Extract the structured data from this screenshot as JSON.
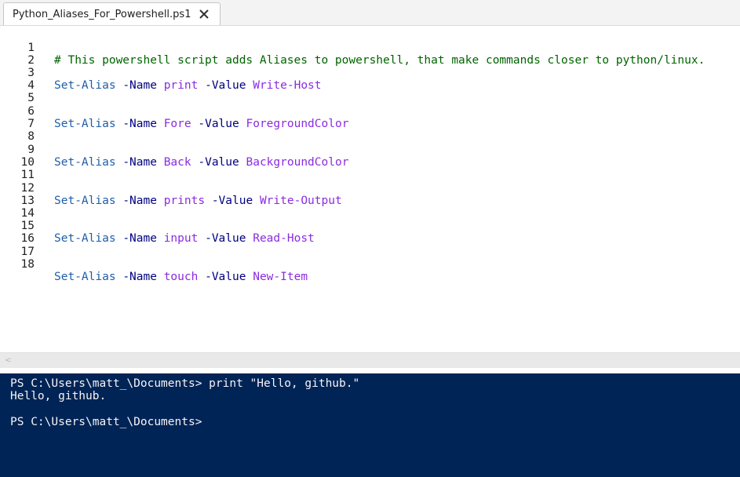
{
  "tab": {
    "title": "Python_Aliases_For_Powershell.ps1",
    "close_icon": "close-icon"
  },
  "editor": {
    "lines": [
      {
        "num": "1",
        "comment": "# This powershell script adds Aliases to powershell, that make commands closer to python/linux."
      },
      {
        "num": "2"
      },
      {
        "num": "3",
        "cmd": "Set-Alias",
        "p1": "-Name",
        "name": "print",
        "p2": "-Value",
        "value": "Write-Host"
      },
      {
        "num": "4"
      },
      {
        "num": "5"
      },
      {
        "num": "6",
        "cmd": "Set-Alias",
        "p1": "-Name",
        "name": "Fore",
        "p2": "-Value",
        "value": "ForegroundColor"
      },
      {
        "num": "7"
      },
      {
        "num": "8"
      },
      {
        "num": "9",
        "cmd": "Set-Alias",
        "p1": "-Name",
        "name": "Back",
        "p2": "-Value",
        "value": "BackgroundColor"
      },
      {
        "num": "10"
      },
      {
        "num": "11"
      },
      {
        "num": "12",
        "cmd": "Set-Alias",
        "p1": "-Name",
        "name": "prints",
        "p2": "-Value",
        "value": "Write-Output"
      },
      {
        "num": "13"
      },
      {
        "num": "14"
      },
      {
        "num": "15",
        "cmd": "Set-Alias",
        "p1": "-Name",
        "name": "input",
        "p2": "-Value",
        "value": "Read-Host"
      },
      {
        "num": "16"
      },
      {
        "num": "17"
      },
      {
        "num": "18",
        "cmd": "Set-Alias",
        "p1": "-Name",
        "name": "touch",
        "p2": "-Value",
        "value": "New-Item"
      }
    ]
  },
  "scrollbar": {
    "left_arrow": "<"
  },
  "console": {
    "lines": [
      "PS C:\\Users\\matt_\\Documents> print \"Hello, github.\"",
      "Hello, github.",
      "",
      "PS C:\\Users\\matt_\\Documents>"
    ]
  },
  "colors": {
    "console_bg": "#012456",
    "command": "#1f5ea8",
    "parameter": "#000080",
    "argument": "#8a2be2",
    "comment": "#006400"
  }
}
